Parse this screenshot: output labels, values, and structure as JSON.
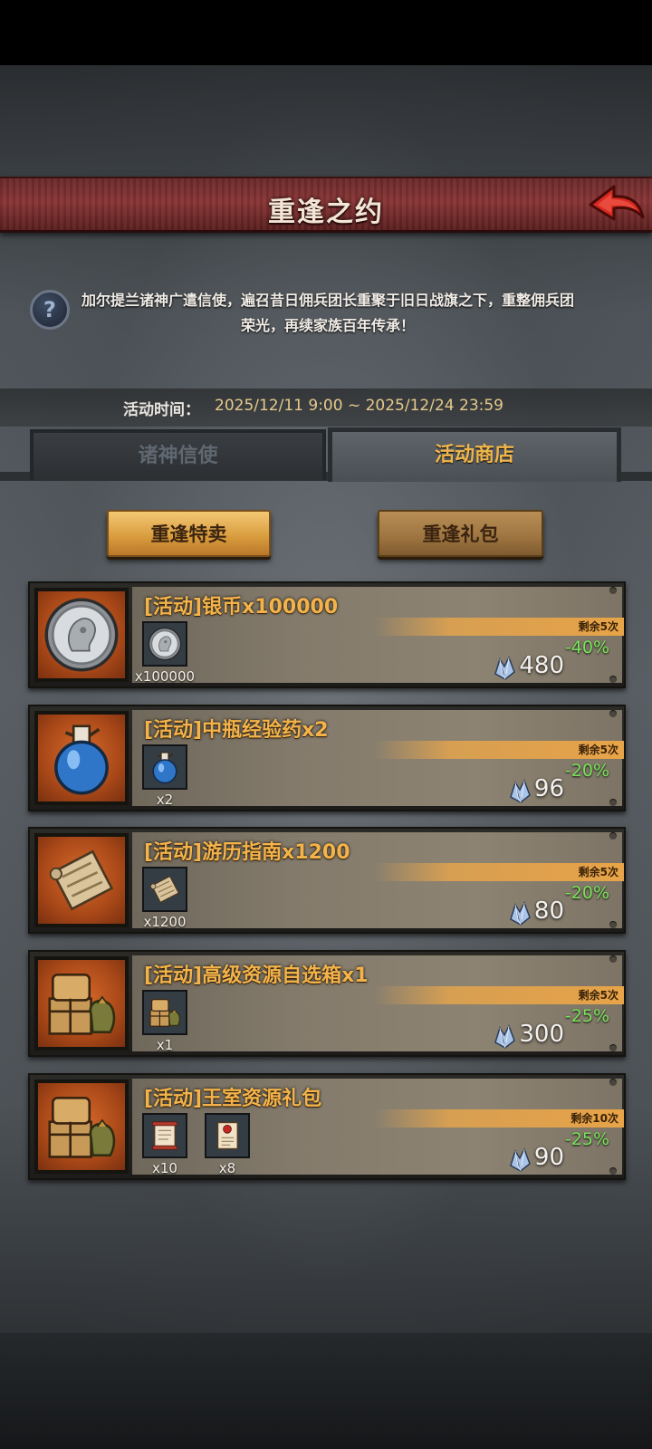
{
  "header": {
    "title": "重逢之约"
  },
  "description": "加尔提兰诸神广遣信使，遍召昔日佣兵团长重聚于旧日战旗之下，重整佣兵团荣光，再续家族百年传承！",
  "event_time": {
    "label": "活动时间：",
    "value": "2025/12/11 9:00 ~ 2025/12/24 23:59"
  },
  "tabs": [
    {
      "label": "诸神信使",
      "active": false
    },
    {
      "label": "活动商店",
      "active": true
    }
  ],
  "subtabs": [
    {
      "label": "重逢特卖",
      "active": true
    },
    {
      "label": "重逢礼包",
      "active": false
    }
  ],
  "items": [
    {
      "name": "[活动]银币x100000",
      "remaining": "剩余5次",
      "discount": "-40%",
      "price": "480",
      "icon": "silver-coin-icon",
      "rewards": [
        {
          "icon": "silver-coin-icon",
          "qty": "x100000"
        }
      ]
    },
    {
      "name": "[活动]中瓶经验药x2",
      "remaining": "剩余5次",
      "discount": "-20%",
      "price": "96",
      "icon": "blue-potion-icon",
      "rewards": [
        {
          "icon": "blue-potion-icon",
          "qty": "x2"
        }
      ]
    },
    {
      "name": "[活动]游历指南x1200",
      "remaining": "剩余5次",
      "discount": "-20%",
      "price": "80",
      "icon": "scroll-map-icon",
      "rewards": [
        {
          "icon": "scroll-map-icon",
          "qty": "x1200"
        }
      ]
    },
    {
      "name": "[活动]高级资源自选箱x1",
      "remaining": "剩余5次",
      "discount": "-25%",
      "price": "300",
      "icon": "resource-chest-icon",
      "rewards": [
        {
          "icon": "resource-chest-icon",
          "qty": "x1"
        }
      ]
    },
    {
      "name": "[活动]王室资源礼包",
      "remaining": "剩余10次",
      "discount": "-25%",
      "price": "90",
      "icon": "resource-chest-icon",
      "rewards": [
        {
          "icon": "red-scroll-icon",
          "qty": "x10"
        },
        {
          "icon": "sealed-letter-icon",
          "qty": "x8"
        }
      ]
    }
  ],
  "colors": {
    "accent_orange": "#f3b34a",
    "discount_green": "#79e35a",
    "banner_red": "#883535"
  }
}
